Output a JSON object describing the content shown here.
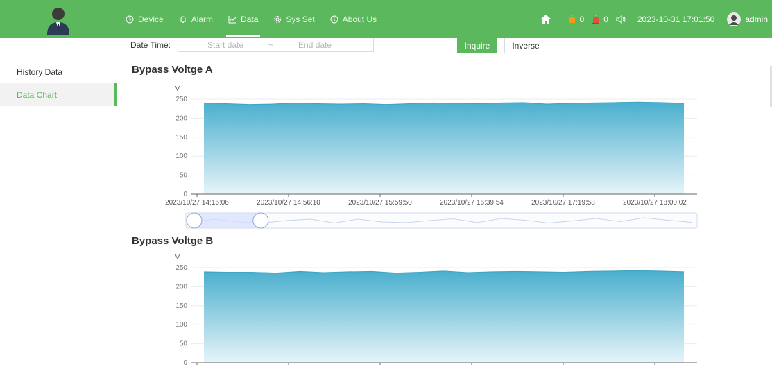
{
  "nav": {
    "items": [
      {
        "label": "Device",
        "icon": "clock-icon"
      },
      {
        "label": "Alarm",
        "icon": "bell-icon"
      },
      {
        "label": "Data",
        "icon": "line-chart-icon"
      },
      {
        "label": "Sys Set",
        "icon": "gear-icon"
      },
      {
        "label": "About Us",
        "icon": "info-icon"
      }
    ],
    "active": "Data"
  },
  "header": {
    "alarm_count_1": "0",
    "alarm_count_2": "0",
    "datetime": "2023-10-31 17:01:50",
    "user": "admin"
  },
  "sidebar": {
    "items": [
      {
        "label": "History Data"
      },
      {
        "label": "Data Chart"
      }
    ],
    "active": "Data Chart"
  },
  "filters": {
    "label": "Date Time:",
    "start_placeholder": "Start date",
    "separator": "~",
    "end_placeholder": "End date",
    "inquire_label": "Inquire",
    "inverse_label": "Inverse"
  },
  "colors": {
    "brand": "#5cb85c",
    "area_top": "#4aafce",
    "area_bottom": "#e6f4f9"
  },
  "chart_data": [
    {
      "type": "area",
      "title": "Bypass Voltge A",
      "ylabel": "V",
      "ylim": [
        0,
        250
      ],
      "yticks": [
        0,
        50,
        100,
        150,
        200,
        250
      ],
      "xticklabels": [
        "2023/10/27 14:16:06",
        "2023/10/27 14:56:10",
        "2023/10/27 15:59:50",
        "2023/10/27 16:39:54",
        "2023/10/27 17:19:58",
        "2023/10/27 18:00:02"
      ],
      "values": [
        240,
        238,
        236,
        237,
        240,
        238,
        237,
        238,
        236,
        238,
        240,
        239,
        238,
        240,
        241,
        237,
        239,
        240,
        241,
        242,
        241,
        239
      ],
      "grid": true,
      "zoom": {
        "start": 0.0,
        "end": 0.13
      }
    },
    {
      "type": "area",
      "title": "Bypass Voltge B",
      "ylabel": "V",
      "ylim": [
        0,
        250
      ],
      "yticks": [
        0,
        50,
        100,
        150,
        200,
        250
      ],
      "xticklabels": [],
      "values": [
        239,
        238,
        238,
        236,
        240,
        237,
        239,
        240,
        236,
        238,
        241,
        237,
        239,
        240,
        239,
        238,
        240,
        241,
        242,
        241,
        239
      ],
      "grid": true
    }
  ]
}
